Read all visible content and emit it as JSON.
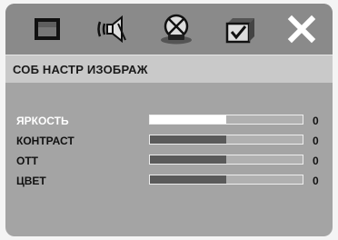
{
  "menu": {
    "icons": [
      {
        "name": "screen-icon",
        "selected": false
      },
      {
        "name": "audio-speaker-icon",
        "selected": false
      },
      {
        "name": "video-disc-icon",
        "selected": true
      },
      {
        "name": "preferences-check-icon",
        "selected": false
      },
      {
        "name": "close-icon",
        "selected": false
      }
    ],
    "title": "СОБ НАСТР ИЗОБРАЖ"
  },
  "settings": [
    {
      "label": "ЯРКОСТЬ",
      "value": "0",
      "level": 0.5,
      "selected": true
    },
    {
      "label": "КОНТРАСТ",
      "value": "0",
      "level": 0.5,
      "selected": false
    },
    {
      "label": "ОТТ",
      "value": "0",
      "level": 0.5,
      "selected": false
    },
    {
      "label": "ЦВЕТ",
      "value": "0",
      "level": 0.5,
      "selected": false
    }
  ],
  "colors": {
    "toolbar": "#8a8a8a",
    "panel": "#a4a4a4",
    "title_bar": "#c9c9c9",
    "bar_fill": "#5a5a5a",
    "selected": "#ffffff"
  }
}
